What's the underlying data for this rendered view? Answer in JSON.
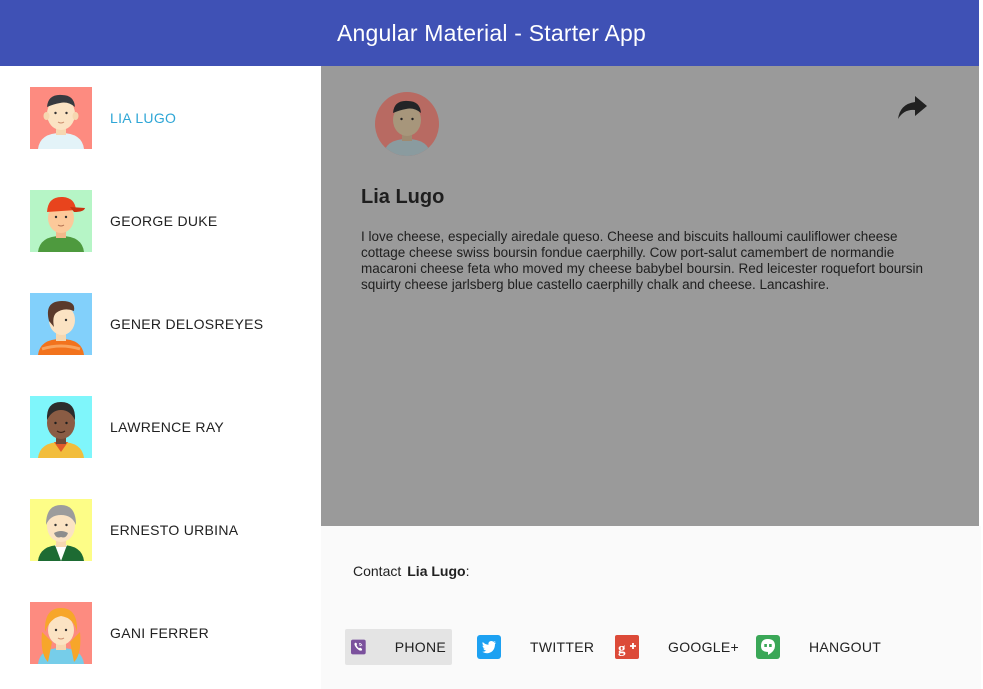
{
  "app": {
    "title": "Angular Material - Starter App"
  },
  "sidebar": {
    "users": [
      {
        "name": "LIA LUGO",
        "avatar": "avatar-lia",
        "bg": "#fd8b80",
        "selected": true
      },
      {
        "name": "GEORGE DUKE",
        "avatar": "avatar-george",
        "bg": "#b6f5c6",
        "selected": false
      },
      {
        "name": "GENER DELOSREYES",
        "avatar": "avatar-gener",
        "bg": "#82d0fb",
        "selected": false
      },
      {
        "name": "LAWRENCE RAY",
        "avatar": "avatar-lawrence",
        "bg": "#7ff6fb",
        "selected": false
      },
      {
        "name": "ERNESTO URBINA",
        "avatar": "avatar-ernesto",
        "bg": "#fdfd87",
        "selected": false
      },
      {
        "name": "GANI FERRER",
        "avatar": "avatar-gani",
        "bg": "#fd8b80",
        "selected": false
      }
    ]
  },
  "detail": {
    "name": "Lia Lugo",
    "bio": "I love cheese, especially airedale queso. Cheese and biscuits halloumi cauliflower cheese cottage cheese swiss boursin fondue caerphilly. Cow port-salut camembert de normandie macaroni cheese feta who moved my cheese babybel boursin. Red leicester roquefort boursin squirty cheese jarlsberg blue castello caerphilly chalk and cheese. Lancashire.",
    "share_icon": "share-arrow-icon"
  },
  "contact_sheet": {
    "prefix": "Contact",
    "name": "Lia Lugo",
    "suffix": ":",
    "items": [
      {
        "label": "PHONE",
        "icon": "viber-phone-icon",
        "color": "#7b519d"
      },
      {
        "label": "TWITTER",
        "icon": "twitter-icon",
        "color": "#1da1f2"
      },
      {
        "label": "GOOGLE+",
        "icon": "google-plus-icon",
        "color": "#dc4a38"
      },
      {
        "label": "HANGOUT",
        "icon": "hangout-icon",
        "color": "#3aa757"
      }
    ]
  },
  "colors": {
    "primary": "#3f51b5",
    "selected_text": "#2ea6d6",
    "backdrop": "#9a9a9a"
  }
}
